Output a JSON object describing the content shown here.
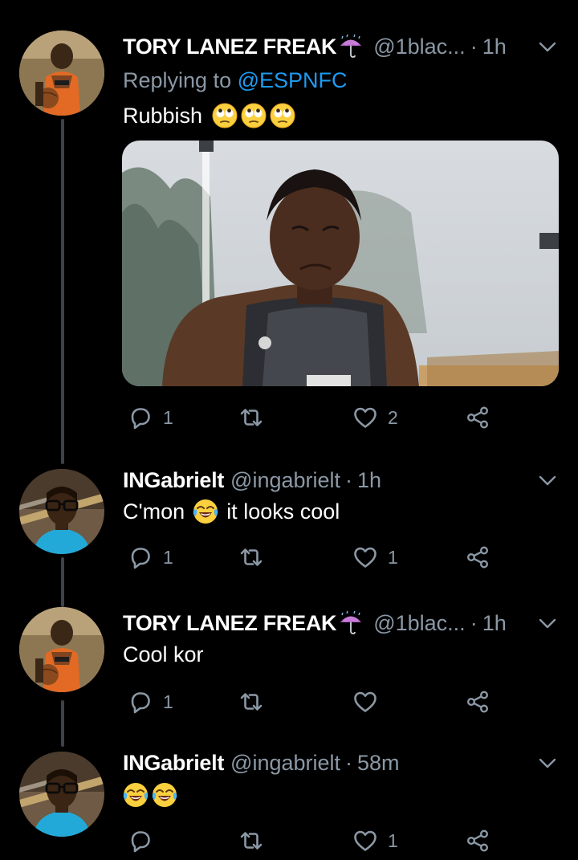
{
  "colors": {
    "background": "#000000",
    "text": "#ffffff",
    "muted": "#8b98a5",
    "link": "#1d9bf0",
    "thread_line": "#3d4248"
  },
  "tweets": [
    {
      "name": "TORY LANEZ FREAK",
      "name_emoji": "umbrella-with-rain-icon",
      "handle": "@1blac...",
      "separator": "·",
      "time": "1h",
      "reply_prefix": "Replying to ",
      "reply_mention": "@ESPNFC",
      "text": "Rubbish",
      "emojis": [
        "face-with-rolling-eyes",
        "face-with-rolling-eyes",
        "face-with-rolling-eyes"
      ],
      "has_media": true,
      "actions": {
        "reply_count": "1",
        "retweet_count": "",
        "like_count": "2"
      }
    },
    {
      "name": "INGabrielt",
      "handle": "@ingabrielt",
      "separator": "·",
      "time": "1h",
      "text_before": "C'mon",
      "emojis": [
        "face-with-tears-of-joy"
      ],
      "text_after": "it looks cool",
      "actions": {
        "reply_count": "1",
        "retweet_count": "",
        "like_count": "1"
      }
    },
    {
      "name": "TORY LANEZ FREAK",
      "name_emoji": "umbrella-with-rain-icon",
      "handle": "@1blac...",
      "separator": "·",
      "time": "1h",
      "text": "Cool kor",
      "actions": {
        "reply_count": "1",
        "retweet_count": "",
        "like_count": ""
      }
    },
    {
      "name": "INGabrielt",
      "handle": "@ingabrielt",
      "separator": "·",
      "time": "58m",
      "emojis": [
        "face-with-tears-of-joy",
        "face-with-tears-of-joy"
      ],
      "actions": {
        "reply_count": "",
        "retweet_count": "",
        "like_count": "1"
      }
    }
  ]
}
